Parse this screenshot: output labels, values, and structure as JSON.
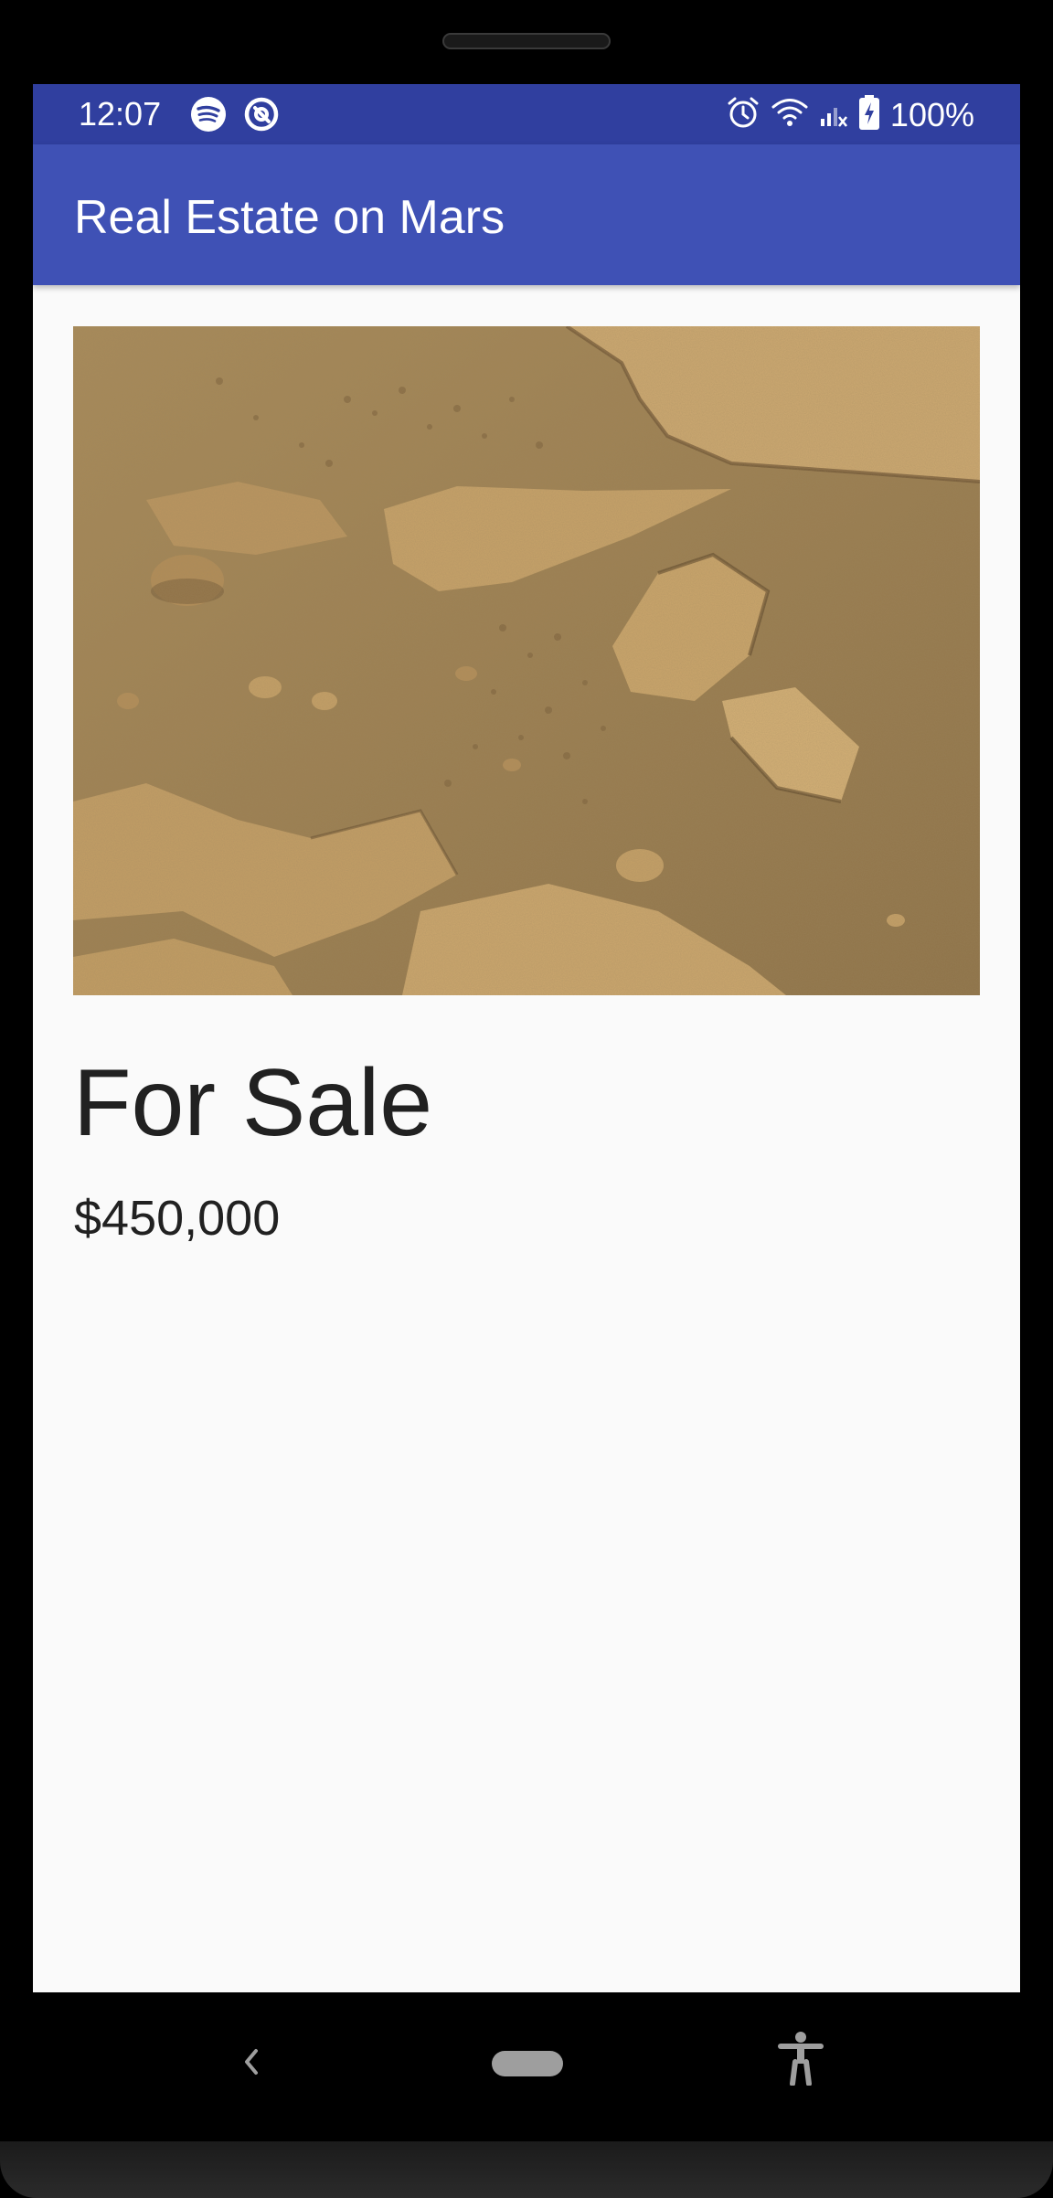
{
  "status_bar": {
    "time": "12:07",
    "left_icons": [
      "spotify-icon",
      "at-sign-icon"
    ],
    "right_icons": [
      "alarm-icon",
      "wifi-icon",
      "signal-icon",
      "battery-charging-icon"
    ],
    "battery": "100%",
    "color": "#303f9f"
  },
  "app_bar": {
    "title": "Real Estate on Mars",
    "color": "#3f51b5"
  },
  "listing": {
    "image_icon": "mars-terrain-photo",
    "heading": "For Sale",
    "price": "$450,000"
  },
  "nav_bar": {
    "buttons": [
      "back-icon",
      "home-pill-icon",
      "accessibility-icon"
    ]
  }
}
